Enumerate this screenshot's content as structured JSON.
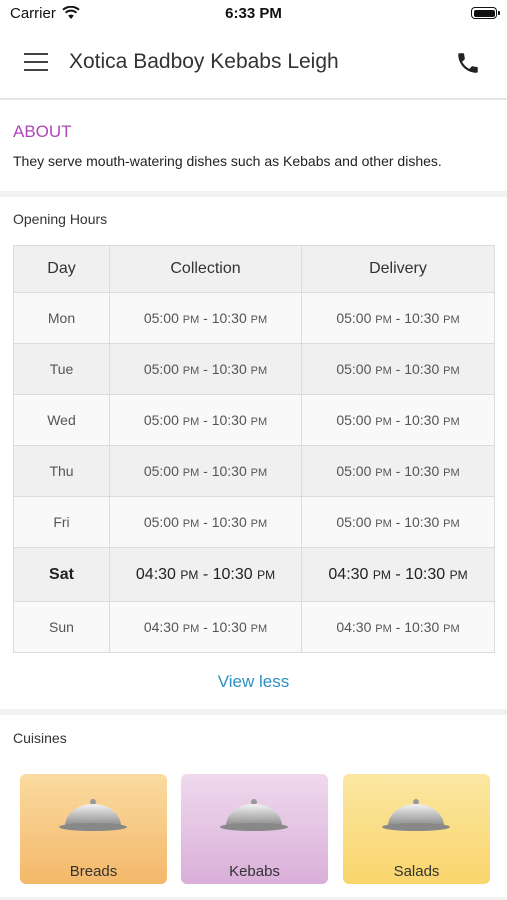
{
  "status_bar": {
    "carrier": "Carrier",
    "time": "6:33 PM"
  },
  "header": {
    "title": "Xotica Badboy Kebabs Leigh",
    "menu_icon": "hamburger-menu-icon",
    "phone_icon": "phone-icon"
  },
  "about": {
    "heading": "ABOUT",
    "text": "They serve mouth-watering dishes such as Kebabs and other dishes."
  },
  "opening_hours": {
    "title": "Opening Hours",
    "headers": [
      "Day",
      "Collection",
      "Delivery"
    ],
    "rows": [
      {
        "day": "Mon",
        "collection": {
          "from": "05:00",
          "to": "10:30",
          "suffix": "PM"
        },
        "delivery": {
          "from": "05:00",
          "to": "10:30",
          "suffix": "PM"
        }
      },
      {
        "day": "Tue",
        "collection": {
          "from": "05:00",
          "to": "10:30",
          "suffix": "PM"
        },
        "delivery": {
          "from": "05:00",
          "to": "10:30",
          "suffix": "PM"
        }
      },
      {
        "day": "Wed",
        "collection": {
          "from": "05:00",
          "to": "10:30",
          "suffix": "PM"
        },
        "delivery": {
          "from": "05:00",
          "to": "10:30",
          "suffix": "PM"
        }
      },
      {
        "day": "Thu",
        "collection": {
          "from": "05:00",
          "to": "10:30",
          "suffix": "PM"
        },
        "delivery": {
          "from": "05:00",
          "to": "10:30",
          "suffix": "PM"
        }
      },
      {
        "day": "Fri",
        "collection": {
          "from": "05:00",
          "to": "10:30",
          "suffix": "PM"
        },
        "delivery": {
          "from": "05:00",
          "to": "10:30",
          "suffix": "PM"
        }
      },
      {
        "day": "Sat",
        "today": true,
        "collection": {
          "from": "04:30",
          "to": "10:30",
          "suffix": "PM"
        },
        "delivery": {
          "from": "04:30",
          "to": "10:30",
          "suffix": "PM"
        }
      },
      {
        "day": "Sun",
        "collection": {
          "from": "04:30",
          "to": "10:30",
          "suffix": "PM"
        },
        "delivery": {
          "from": "04:30",
          "to": "10:30",
          "suffix": "PM"
        }
      }
    ],
    "view_less": "View less"
  },
  "cuisines": {
    "title": "Cuisines",
    "items": [
      {
        "label": "Breads",
        "color_top": "#fadba0",
        "color_bottom": "#f4b86a",
        "icon": "cloche-icon"
      },
      {
        "label": "Kebabs",
        "color_top": "#efd9ed",
        "color_bottom": "#d9afd9",
        "icon": "cloche-icon"
      },
      {
        "label": "Salads",
        "color_top": "#fbe7a2",
        "color_bottom": "#f9d56c",
        "icon": "cloche-icon"
      }
    ]
  },
  "colors": {
    "accent_about": "#b147b6",
    "link": "#2b90c4"
  }
}
